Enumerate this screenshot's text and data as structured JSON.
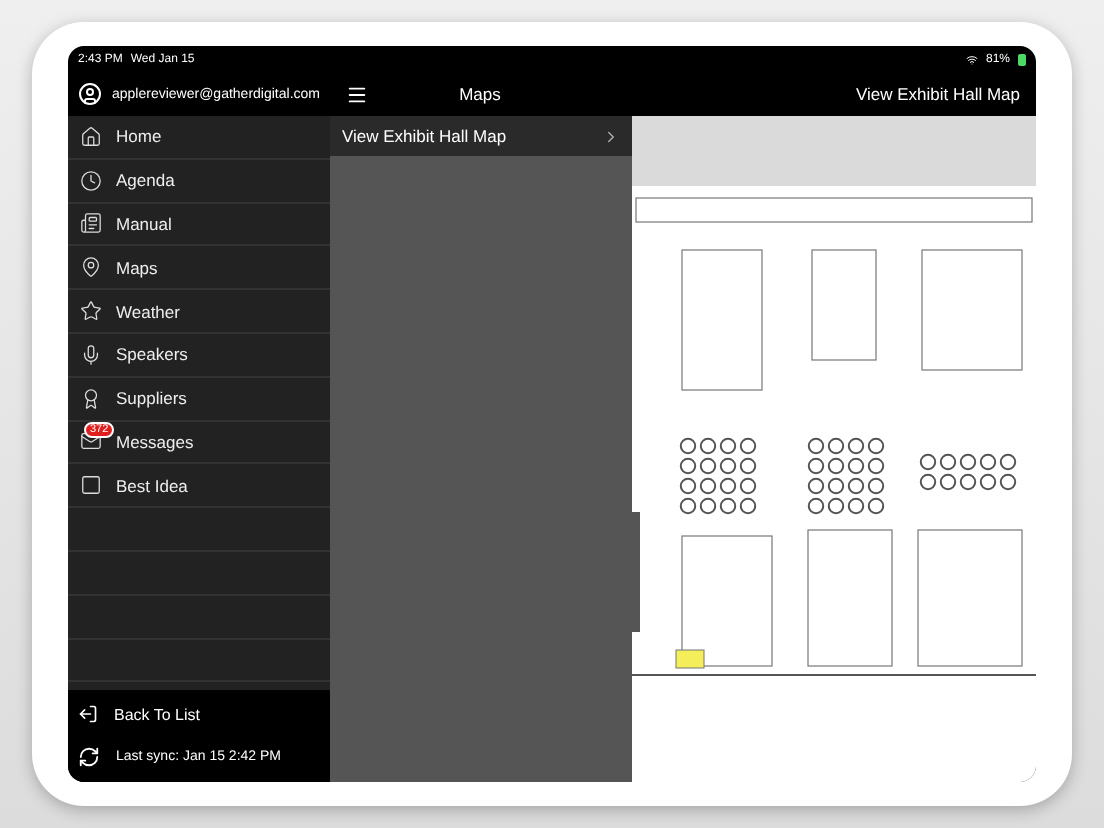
{
  "status_bar": {
    "time": "2:43 PM",
    "date": "Wed Jan 15",
    "battery": "81%"
  },
  "account": {
    "email": "applereviewer@gatherdigital.com"
  },
  "header": {
    "title": "Maps",
    "detail_title": "View Exhibit Hall Map"
  },
  "menu": [
    {
      "label": "Home"
    },
    {
      "label": "Agenda"
    },
    {
      "label": "Manual"
    },
    {
      "label": "Maps"
    },
    {
      "label": "Weather"
    },
    {
      "label": "Speakers"
    },
    {
      "label": "Suppliers"
    },
    {
      "label": "Messages",
      "badge": "372"
    },
    {
      "label": "Best Idea"
    }
  ],
  "footer": {
    "back": "Back To List",
    "sync": "Last sync:  Jan 15 2:42 PM"
  },
  "maps": [
    {
      "label": "View Exhibit Hall Map"
    }
  ]
}
